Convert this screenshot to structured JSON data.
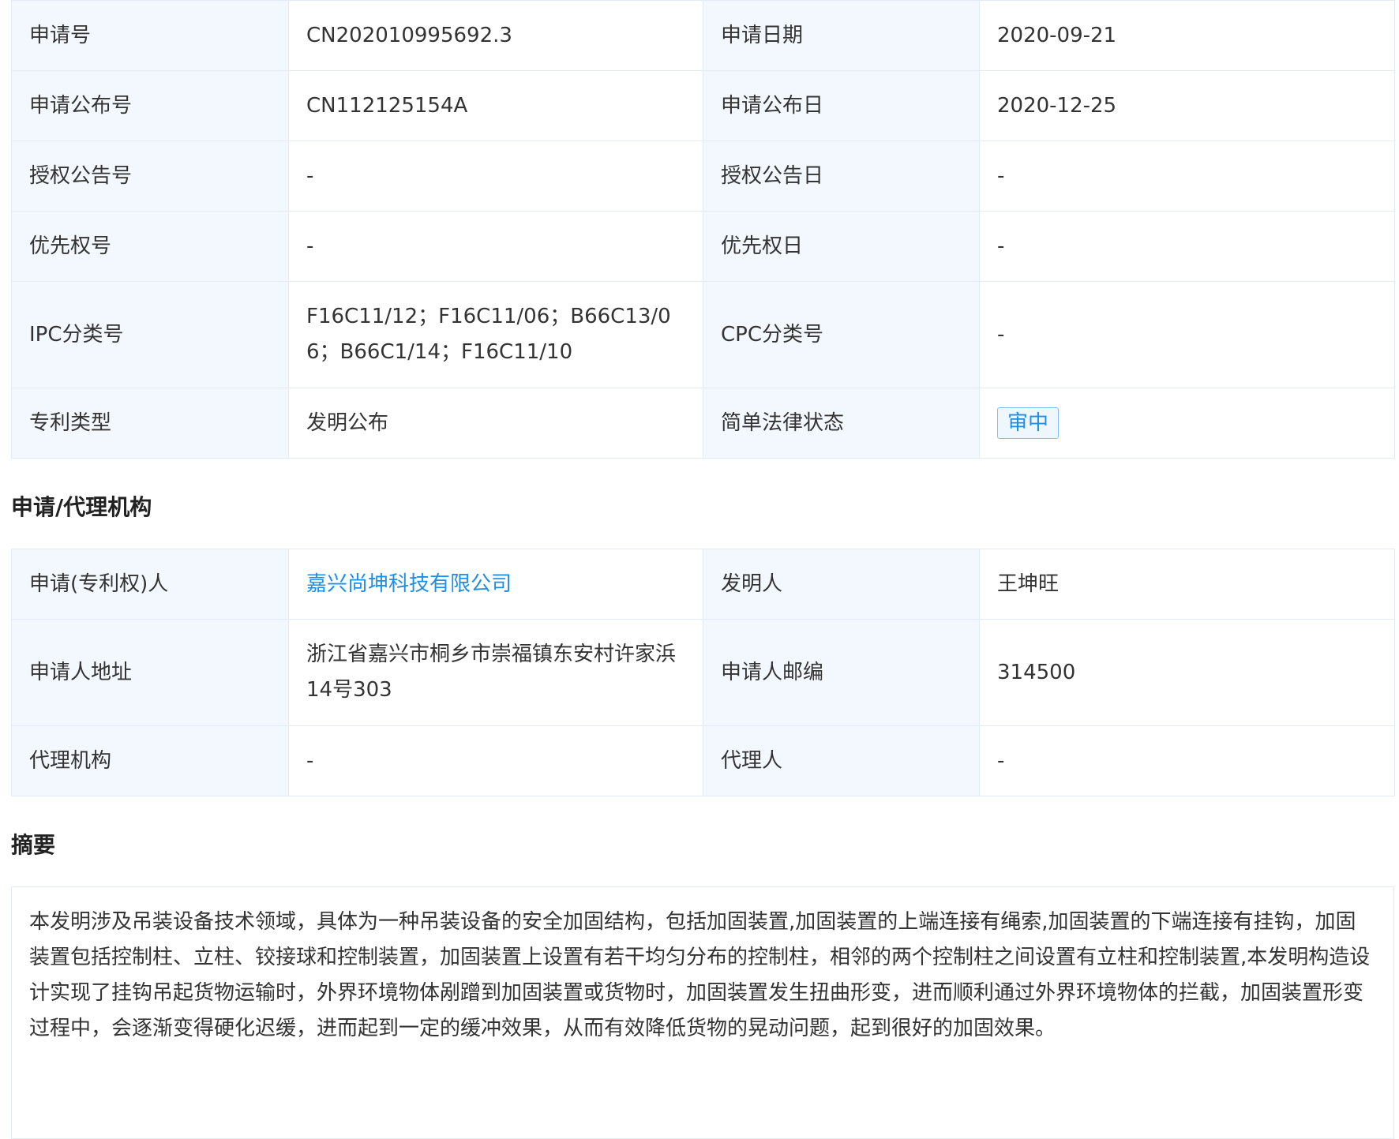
{
  "basic": {
    "rows": [
      {
        "l1": "申请号",
        "v1": "CN202010995692.3",
        "l2": "申请日期",
        "v2": "2020-09-21"
      },
      {
        "l1": "申请公布号",
        "v1": "CN112125154A",
        "l2": "申请公布日",
        "v2": "2020-12-25"
      },
      {
        "l1": "授权公告号",
        "v1": "-",
        "l2": "授权公告日",
        "v2": "-"
      },
      {
        "l1": "优先权号",
        "v1": "-",
        "l2": "优先权日",
        "v2": "-"
      },
      {
        "l1": "IPC分类号",
        "v1": "F16C11/12；F16C11/06；B66C13/06；B66C1/14；F16C11/10",
        "l2": "CPC分类号",
        "v2": "-"
      },
      {
        "l1": "专利类型",
        "v1": "发明公布",
        "l2": "简单法律状态",
        "v2": "审中"
      }
    ]
  },
  "agency": {
    "title": "申请/代理机构",
    "rows": [
      {
        "l1": "申请(专利权)人",
        "v1": "嘉兴尚坤科技有限公司",
        "l2": "发明人",
        "v2": "王坤旺"
      },
      {
        "l1": "申请人地址",
        "v1": "浙江省嘉兴市桐乡市崇福镇东安村许家浜14号303",
        "l2": "申请人邮编",
        "v2": "314500"
      },
      {
        "l1": "代理机构",
        "v1": "-",
        "l2": "代理人",
        "v2": "-"
      }
    ]
  },
  "abstract": {
    "title": "摘要",
    "text": "本发明涉及吊装设备技术领域，具体为一种吊装设备的安全加固结构，包括加固装置,加固装置的上端连接有绳索,加固装置的下端连接有挂钩，加固装置包括控制柱、立柱、铰接球和控制装置，加固装置上设置有若干均匀分布的控制柱，相邻的两个控制柱之间设置有立柱和控制装置,本发明构造设计实现了挂钩吊起货物运输时，外界环境物体剐蹭到加固装置或货物时，加固装置发生扭曲形变，进而顺利通过外界环境物体的拦截，加固装置形变过程中，会逐渐变得硬化迟缓，进而起到一定的缓冲效果，从而有效降低货物的晃动问题，起到很好的加固效果。"
  },
  "colors": {
    "label_bg": "#f2f8fd",
    "border": "#e3ecf6",
    "link": "#1f8fe5",
    "text": "#333333"
  }
}
